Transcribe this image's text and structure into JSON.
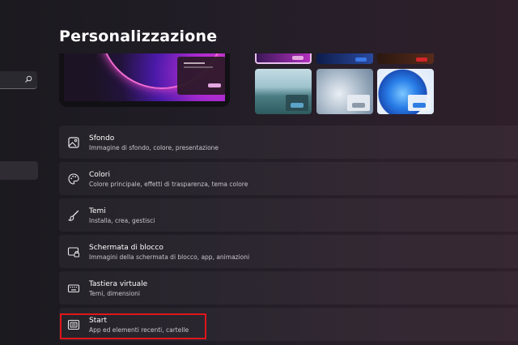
{
  "header": {
    "title": "Personalizzazione"
  },
  "nav": {
    "search": {
      "value": "",
      "placeholder": "",
      "icon": "search-icon"
    }
  },
  "preview": {
    "colors": {
      "accent": "#e4a7e0"
    }
  },
  "themes": [
    {
      "icon": "theme-thumbnail-glow",
      "selected": true
    },
    {
      "icon": "theme-thumbnail-blue"
    },
    {
      "icon": "theme-thumbnail-red"
    },
    {
      "icon": "theme-thumbnail-lake"
    },
    {
      "icon": "theme-thumbnail-captured-motion"
    },
    {
      "icon": "theme-thumbnail-bloom"
    }
  ],
  "settings": [
    {
      "title": "Sfondo",
      "description": "Immagine di sfondo, colore, presentazione",
      "icon": "image-icon"
    },
    {
      "title": "Colori",
      "description": "Colore principale, effetti di trasparenza, tema colore",
      "icon": "palette-icon"
    },
    {
      "title": "Temi",
      "description": "Installa, crea, gestisci",
      "icon": "brush-icon"
    },
    {
      "title": "Schermata di blocco",
      "description": "Immagini della schermata di blocco, app, animazioni",
      "icon": "lock-screen-icon"
    },
    {
      "title": "Tastiera virtuale",
      "description": "Temi, dimensioni",
      "icon": "keyboard-icon"
    },
    {
      "title": "Start",
      "description": "App ed elementi recenti, cartelle",
      "icon": "start-icon",
      "highlighted": true
    }
  ],
  "colors": {
    "highlight_border": "#e0161b"
  }
}
